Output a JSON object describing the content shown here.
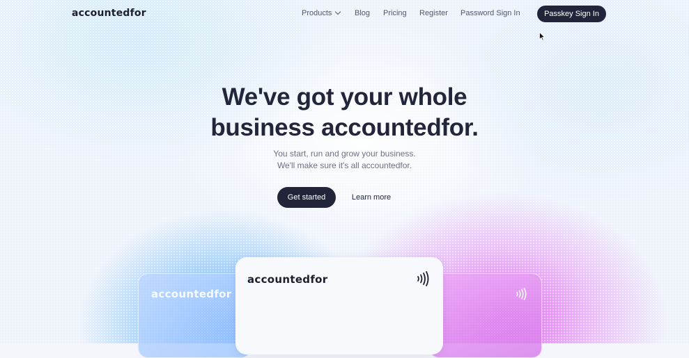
{
  "nav": {
    "logo": "accountedfor",
    "links": [
      {
        "label": "Products"
      },
      {
        "label": "Blog"
      },
      {
        "label": "Pricing"
      },
      {
        "label": "Register"
      },
      {
        "label": "Password Sign In"
      }
    ],
    "passkey_button": "Passkey Sign In"
  },
  "hero": {
    "title_line1": "We've got your whole",
    "title_line2": "business accountedfor.",
    "subtitle_line1": "You start, run and grow your business.",
    "subtitle_line2": "We'll make sure it's all accountedfor.",
    "primary_button": "Get started",
    "secondary_button": "Learn more"
  },
  "cards": {
    "left_logo": "accountedfor",
    "center_logo": "accountedfor"
  },
  "colors": {
    "primary_dark": "#22253a",
    "accent_blue": "#58a0ff",
    "accent_magenta": "#dc50f0"
  },
  "icons": {
    "products_dropdown": "chevron-down-icon",
    "cards": "contactless-icon"
  }
}
